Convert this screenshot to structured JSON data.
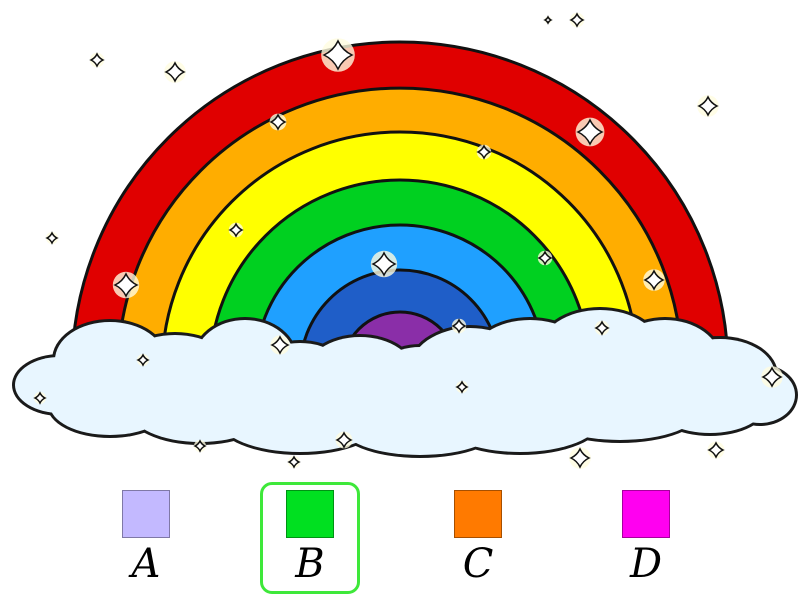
{
  "scene": {
    "bands": [
      {
        "name": "red",
        "color": "#e00000"
      },
      {
        "name": "orange",
        "color": "#ffad00"
      },
      {
        "name": "yellow",
        "color": "#ffff00"
      },
      {
        "name": "green",
        "color": "#00d020"
      },
      {
        "name": "light-blue",
        "color": "#1fa0ff"
      },
      {
        "name": "dark-blue",
        "color": "#1f5ec8"
      },
      {
        "name": "purple",
        "color": "#8a2ea8"
      }
    ],
    "cloud_color": "#e8f6ff",
    "cloud_outline": "#1a1a1a",
    "sparkle_color": "#fffde0"
  },
  "options": [
    {
      "letter": "A",
      "color": "#c3b9ff",
      "selected": false
    },
    {
      "letter": "B",
      "color": "#00e020",
      "selected": true
    },
    {
      "letter": "C",
      "color": "#ff7a00",
      "selected": false
    },
    {
      "letter": "D",
      "color": "#ff00f0",
      "selected": false
    }
  ],
  "selection_color": "#3ee83a"
}
